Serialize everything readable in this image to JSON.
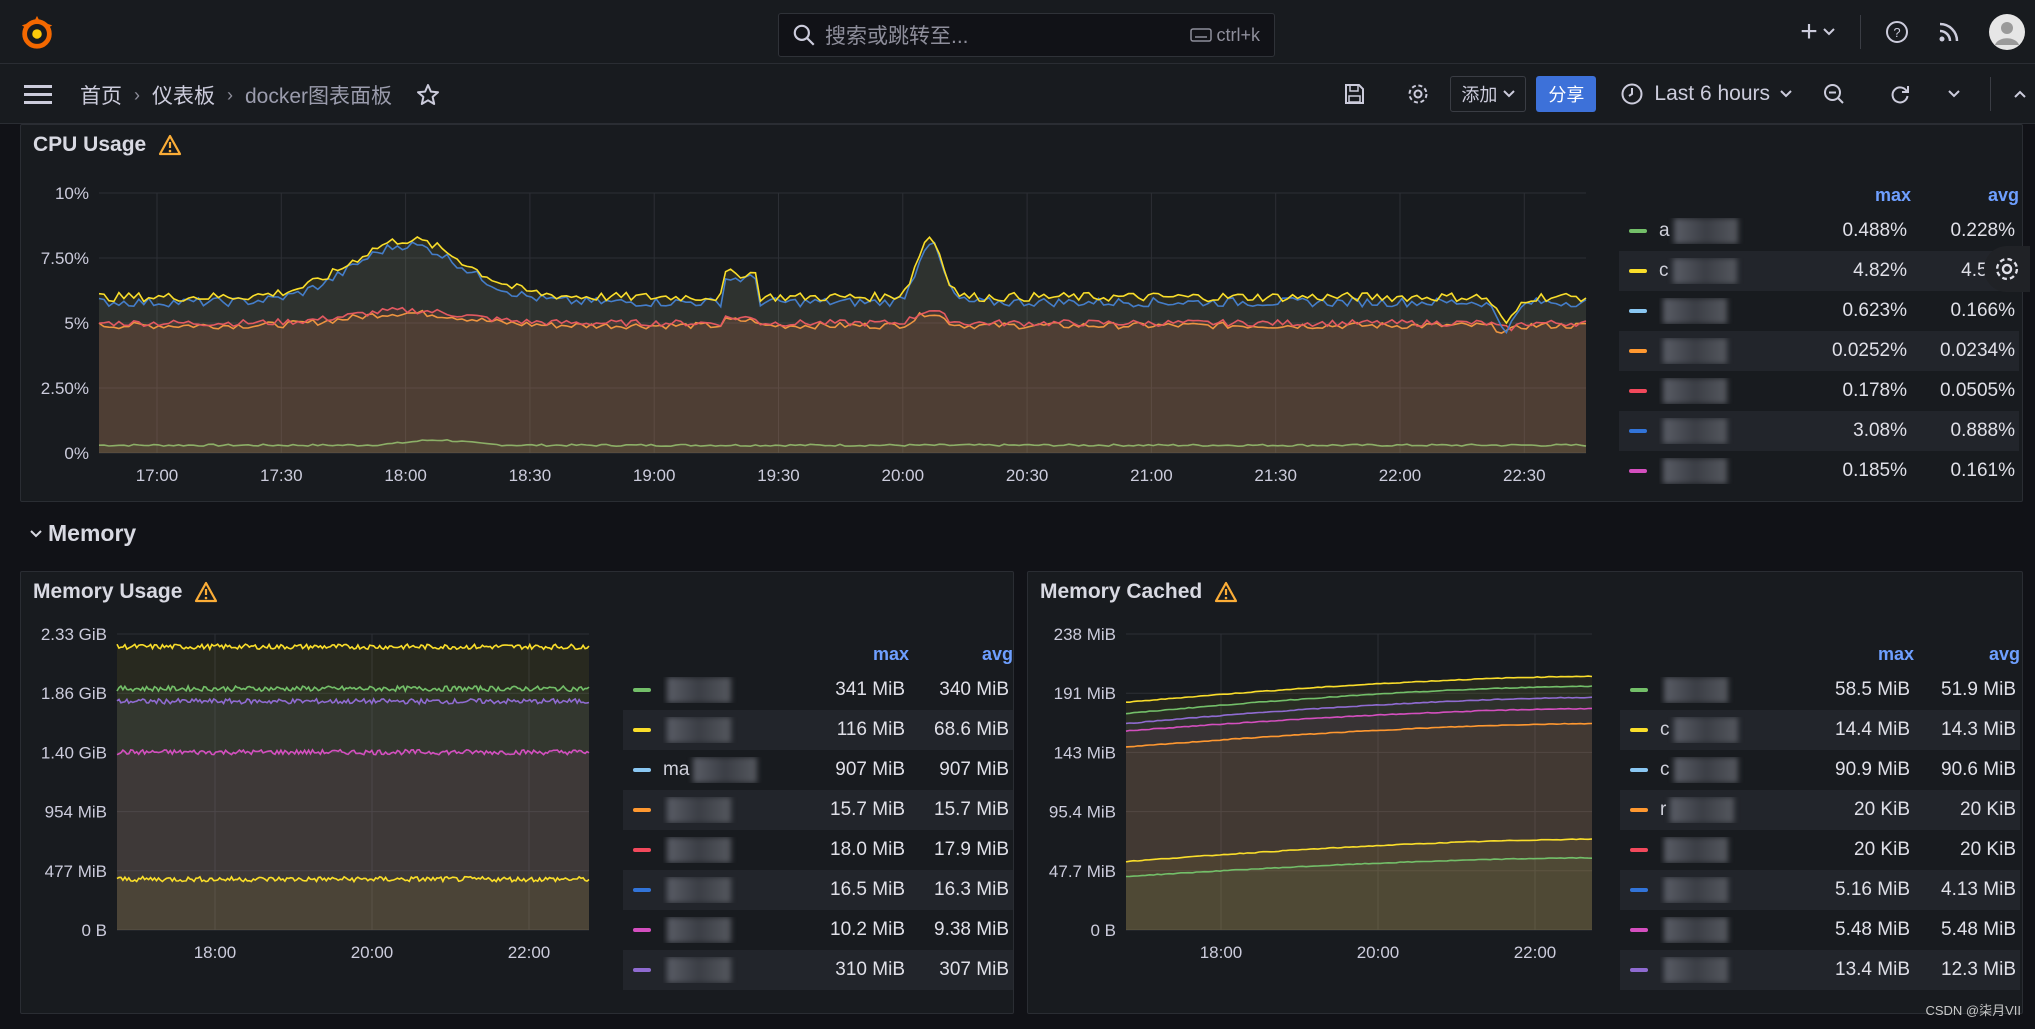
{
  "topbar": {
    "search_placeholder": "搜索或跳转至...",
    "shortcut": "ctrl+k",
    "plus_label": "+"
  },
  "navbar": {
    "breadcrumbs": [
      "首页",
      "仪表板",
      "docker图表面板"
    ],
    "add_label": "添加",
    "share_label": "分享",
    "time_range": "Last 6 hours"
  },
  "colors": {
    "green": "#73bf69",
    "yellow": "#fade2a",
    "cyan": "#5794f2",
    "light_blue": "#8ab8ff",
    "orange": "#ff9830",
    "red": "#f2495c",
    "blue": "#5794f2",
    "magenta": "#b877d9",
    "purple": "#ca95e5",
    "share": "#3d71d9",
    "legend_header": "#6e9fff"
  },
  "cpu_panel": {
    "title": "CPU Usage",
    "legend_headers": {
      "max": "max",
      "avg": "avg"
    },
    "legend": [
      {
        "name": "a",
        "color": "#73bf69",
        "max": "0.488%",
        "avg": "0.228%"
      },
      {
        "name": "c",
        "color": "#fade2a",
        "max": "4.82%",
        "avg": "4.50%"
      },
      {
        "name": "",
        "color": "#8ac7f2",
        "max": "0.623%",
        "avg": "0.166%"
      },
      {
        "name": "",
        "color": "#ff9830",
        "max": "0.0252%",
        "avg": "0.0234%"
      },
      {
        "name": "",
        "color": "#f2495c",
        "max": "0.178%",
        "avg": "0.0505%"
      },
      {
        "name": "",
        "color": "#3274d9",
        "max": "3.08%",
        "avg": "0.888%"
      },
      {
        "name": "",
        "color": "#d44fbf",
        "max": "0.185%",
        "avg": "0.161%"
      }
    ]
  },
  "memory_row": {
    "title": "Memory"
  },
  "memory_usage_panel": {
    "title": "Memory Usage",
    "legend_headers": {
      "max": "max",
      "avg": "avg"
    },
    "legend": [
      {
        "name": "",
        "color": "#73bf69",
        "max": "341 MiB",
        "avg": "340 MiB"
      },
      {
        "name": "",
        "color": "#fade2a",
        "max": "116 MiB",
        "avg": "68.6 MiB"
      },
      {
        "name": "ma",
        "color": "#8ac7f2",
        "max": "907 MiB",
        "avg": "907 MiB"
      },
      {
        "name": "",
        "color": "#ff9830",
        "max": "15.7 MiB",
        "avg": "15.7 MiB"
      },
      {
        "name": "",
        "color": "#f2495c",
        "max": "18.0 MiB",
        "avg": "17.9 MiB"
      },
      {
        "name": "",
        "color": "#3274d9",
        "max": "16.5 MiB",
        "avg": "16.3 MiB"
      },
      {
        "name": "",
        "color": "#d44fbf",
        "max": "10.2 MiB",
        "avg": "9.38 MiB"
      },
      {
        "name": "",
        "color": "#8f6bd1",
        "max": "310 MiB",
        "avg": "307 MiB"
      }
    ]
  },
  "memory_cached_panel": {
    "title": "Memory Cached",
    "legend_headers": {
      "max": "max",
      "avg": "avg"
    },
    "legend": [
      {
        "name": "",
        "color": "#73bf69",
        "max": "58.5 MiB",
        "avg": "51.9 MiB"
      },
      {
        "name": "c",
        "color": "#fade2a",
        "max": "14.4 MiB",
        "avg": "14.3 MiB"
      },
      {
        "name": "c",
        "color": "#8ac7f2",
        "max": "90.9 MiB",
        "avg": "90.6 MiB"
      },
      {
        "name": "r",
        "color": "#ff9830",
        "max": "20 KiB",
        "avg": "20 KiB"
      },
      {
        "name": "",
        "color": "#f2495c",
        "max": "20 KiB",
        "avg": "20 KiB"
      },
      {
        "name": "",
        "color": "#3274d9",
        "max": "5.16 MiB",
        "avg": "4.13 MiB"
      },
      {
        "name": "",
        "color": "#d44fbf",
        "max": "5.48 MiB",
        "avg": "5.48 MiB"
      },
      {
        "name": "",
        "color": "#8f6bd1",
        "max": "13.4 MiB",
        "avg": "12.3 MiB"
      }
    ]
  },
  "chart_data": [
    {
      "type": "line",
      "title": "CPU Usage",
      "y_ticks": [
        "0%",
        "2.50%",
        "5%",
        "7.50%",
        "10%"
      ],
      "ylim": [
        0,
        10
      ],
      "x_ticks": [
        "17:00",
        "17:30",
        "18:00",
        "18:30",
        "19:00",
        "19:30",
        "20:00",
        "20:30",
        "21:00",
        "21:30",
        "22:00",
        "22:30"
      ],
      "series": [
        {
          "color": "#fade2a",
          "approx_level": 6.0
        },
        {
          "color": "#3274d9",
          "approx_level": 5.8
        },
        {
          "color": "#f2495c",
          "approx_level": 5.0
        },
        {
          "color": "#ff9830",
          "approx_level": 4.9
        },
        {
          "color": "#73bf69",
          "approx_level": 0.3
        }
      ]
    },
    {
      "type": "area",
      "title": "Memory Usage",
      "y_ticks": [
        "0 B",
        "477 MiB",
        "954 MiB",
        "1.40 GiB",
        "1.86 GiB",
        "2.33 GiB"
      ],
      "x_ticks": [
        "18:00",
        "20:00",
        "22:00"
      ],
      "series": [
        {
          "color": "#fade2a",
          "approx_level": 2.23
        },
        {
          "color": "#73bf69",
          "approx_level": 1.9
        },
        {
          "color": "#8f6bd1",
          "approx_level": 1.8
        },
        {
          "color": "#d44fbf",
          "approx_level": 1.4
        },
        {
          "color": "#fade2a",
          "approx_level": 0.4
        }
      ]
    },
    {
      "type": "area",
      "title": "Memory Cached",
      "y_ticks": [
        "0 B",
        "47.7 MiB",
        "95.4 MiB",
        "143 MiB",
        "191 MiB",
        "238 MiB"
      ],
      "x_ticks": [
        "18:00",
        "20:00",
        "22:00"
      ],
      "series": [
        {
          "color": "#fade2a",
          "start": 183,
          "end": 204
        },
        {
          "color": "#73bf69",
          "start": 174,
          "end": 196
        },
        {
          "color": "#8f6bd1",
          "start": 166,
          "end": 187
        },
        {
          "color": "#d44fbf",
          "start": 160,
          "end": 178
        },
        {
          "color": "#ff9830",
          "start": 147,
          "end": 166
        },
        {
          "color": "#fade2a",
          "start": 55,
          "end": 73
        },
        {
          "color": "#73bf69",
          "start": 43,
          "end": 58
        }
      ]
    }
  ],
  "watermark": "CSDN @柒月VII"
}
